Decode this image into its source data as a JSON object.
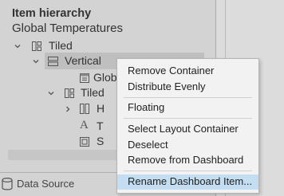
{
  "panel": {
    "title": "Item hierarchy",
    "subtitle": "Global Temperatures"
  },
  "tree": {
    "tiled_root": {
      "label": "Tiled",
      "icon": "tiled-layout-icon",
      "expanded": true
    },
    "vertical": {
      "label": "Vertical",
      "icon": "vertical-container-icon",
      "expanded": true,
      "selected": true
    },
    "global": {
      "label": "Globa",
      "icon": "sheet-icon"
    },
    "tiled_child": {
      "label": "Tiled",
      "icon": "tiled-layout-icon",
      "expanded": true
    },
    "horizontal": {
      "label": "H",
      "icon": "horizontal-container-icon",
      "expanded": false
    },
    "text": {
      "label": "T",
      "icon": "text-object-icon"
    },
    "sheet": {
      "label": "S",
      "icon": "sheet-icon"
    }
  },
  "footer": {
    "data_source_label": "Data Source",
    "icon": "database-icon"
  },
  "context_menu": {
    "items": [
      "Remove Container",
      "Distribute Evenly",
      "Floating",
      "Select Layout Container",
      "Deselect",
      "Remove from Dashboard",
      "Rename Dashboard Item..."
    ],
    "highlighted": "Rename Dashboard Item..."
  },
  "colors": {
    "panel_background": "#d3d3d3",
    "selected_row": "#bfbfbf",
    "menu_background": "#f2f2f2",
    "menu_highlight": "#c3def1",
    "text": "#333333"
  }
}
